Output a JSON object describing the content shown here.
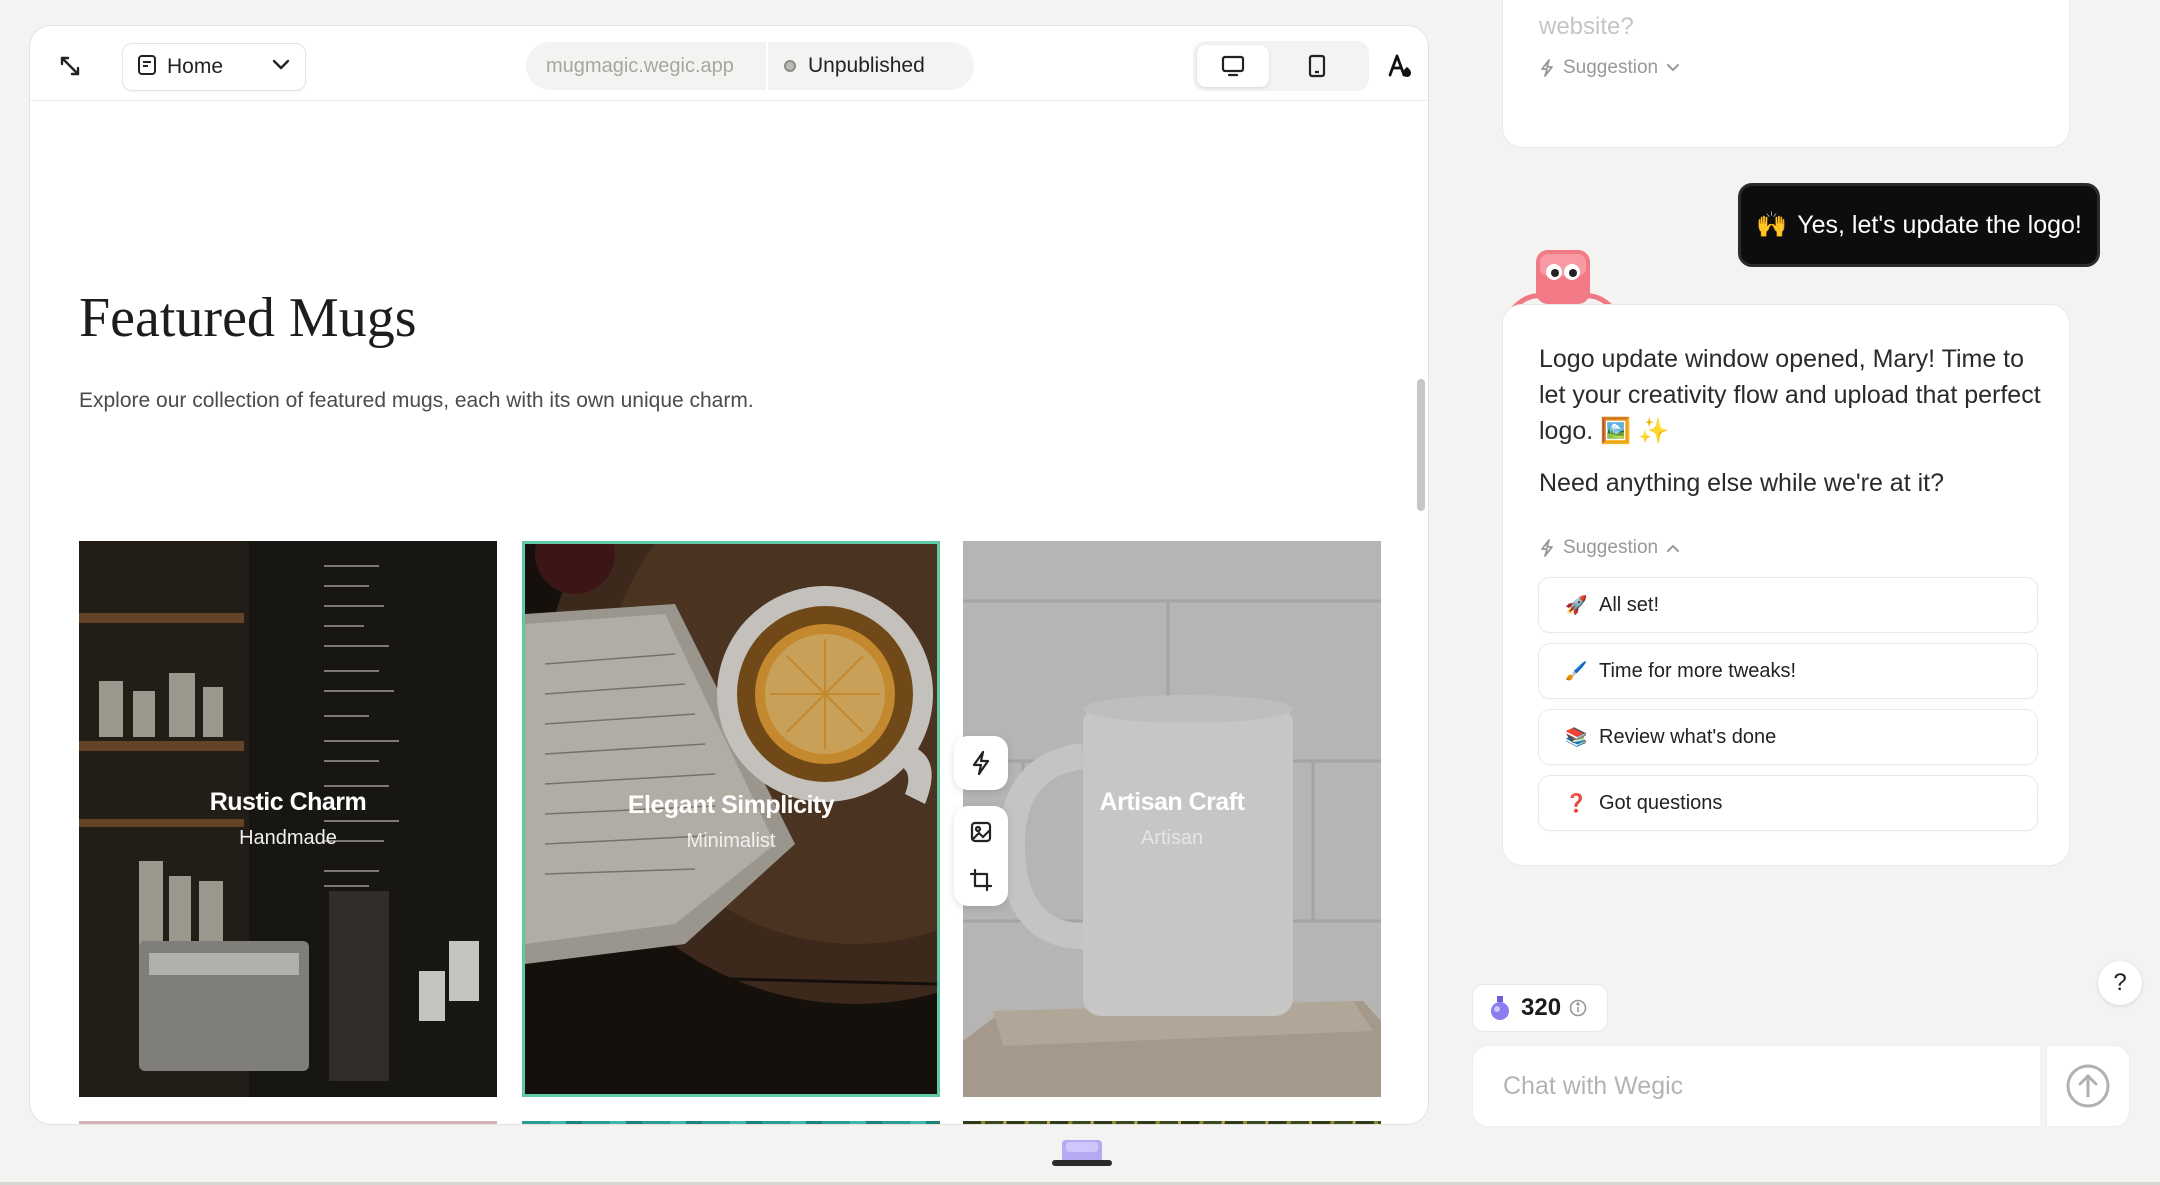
{
  "toolbar": {
    "page_selector": "Home",
    "url": "mugmagic.wegic.app",
    "publish_status": "Unpublished"
  },
  "section": {
    "title": "Featured Mugs",
    "subtitle": "Explore our collection of featured mugs, each with its own unique charm."
  },
  "cards": [
    {
      "title": "Rustic Charm",
      "tag": "Handmade"
    },
    {
      "title": "Elegant Simplicity",
      "tag": "Minimalist"
    },
    {
      "title": "Artisan Craft",
      "tag": "Artisan"
    }
  ],
  "chat": {
    "previous_text": "website?",
    "suggestion_label": "Suggestion",
    "user_message": {
      "emoji": "🙌",
      "text": "Yes, let's update the logo!"
    },
    "assistant_message": {
      "paragraph1": "Logo update window opened, Mary! Time to let your creativity flow and upload that perfect logo. 🖼️ ✨",
      "paragraph2": "Need anything else while we're at it?"
    },
    "suggestions": [
      {
        "emoji": "🚀",
        "label": "All set!"
      },
      {
        "emoji": "🖌️",
        "label": "Time for more tweaks!"
      },
      {
        "emoji": "📚",
        "label": "Review what's done"
      },
      {
        "emoji": "❓",
        "label": "Got questions"
      }
    ],
    "credits": "320",
    "input_placeholder": "Chat with Wegic",
    "help_label": "?"
  },
  "colors": {
    "accent_border": "#5fc9a3",
    "user_bubble": "#0d0d0d",
    "background": "#f4f3f1"
  }
}
